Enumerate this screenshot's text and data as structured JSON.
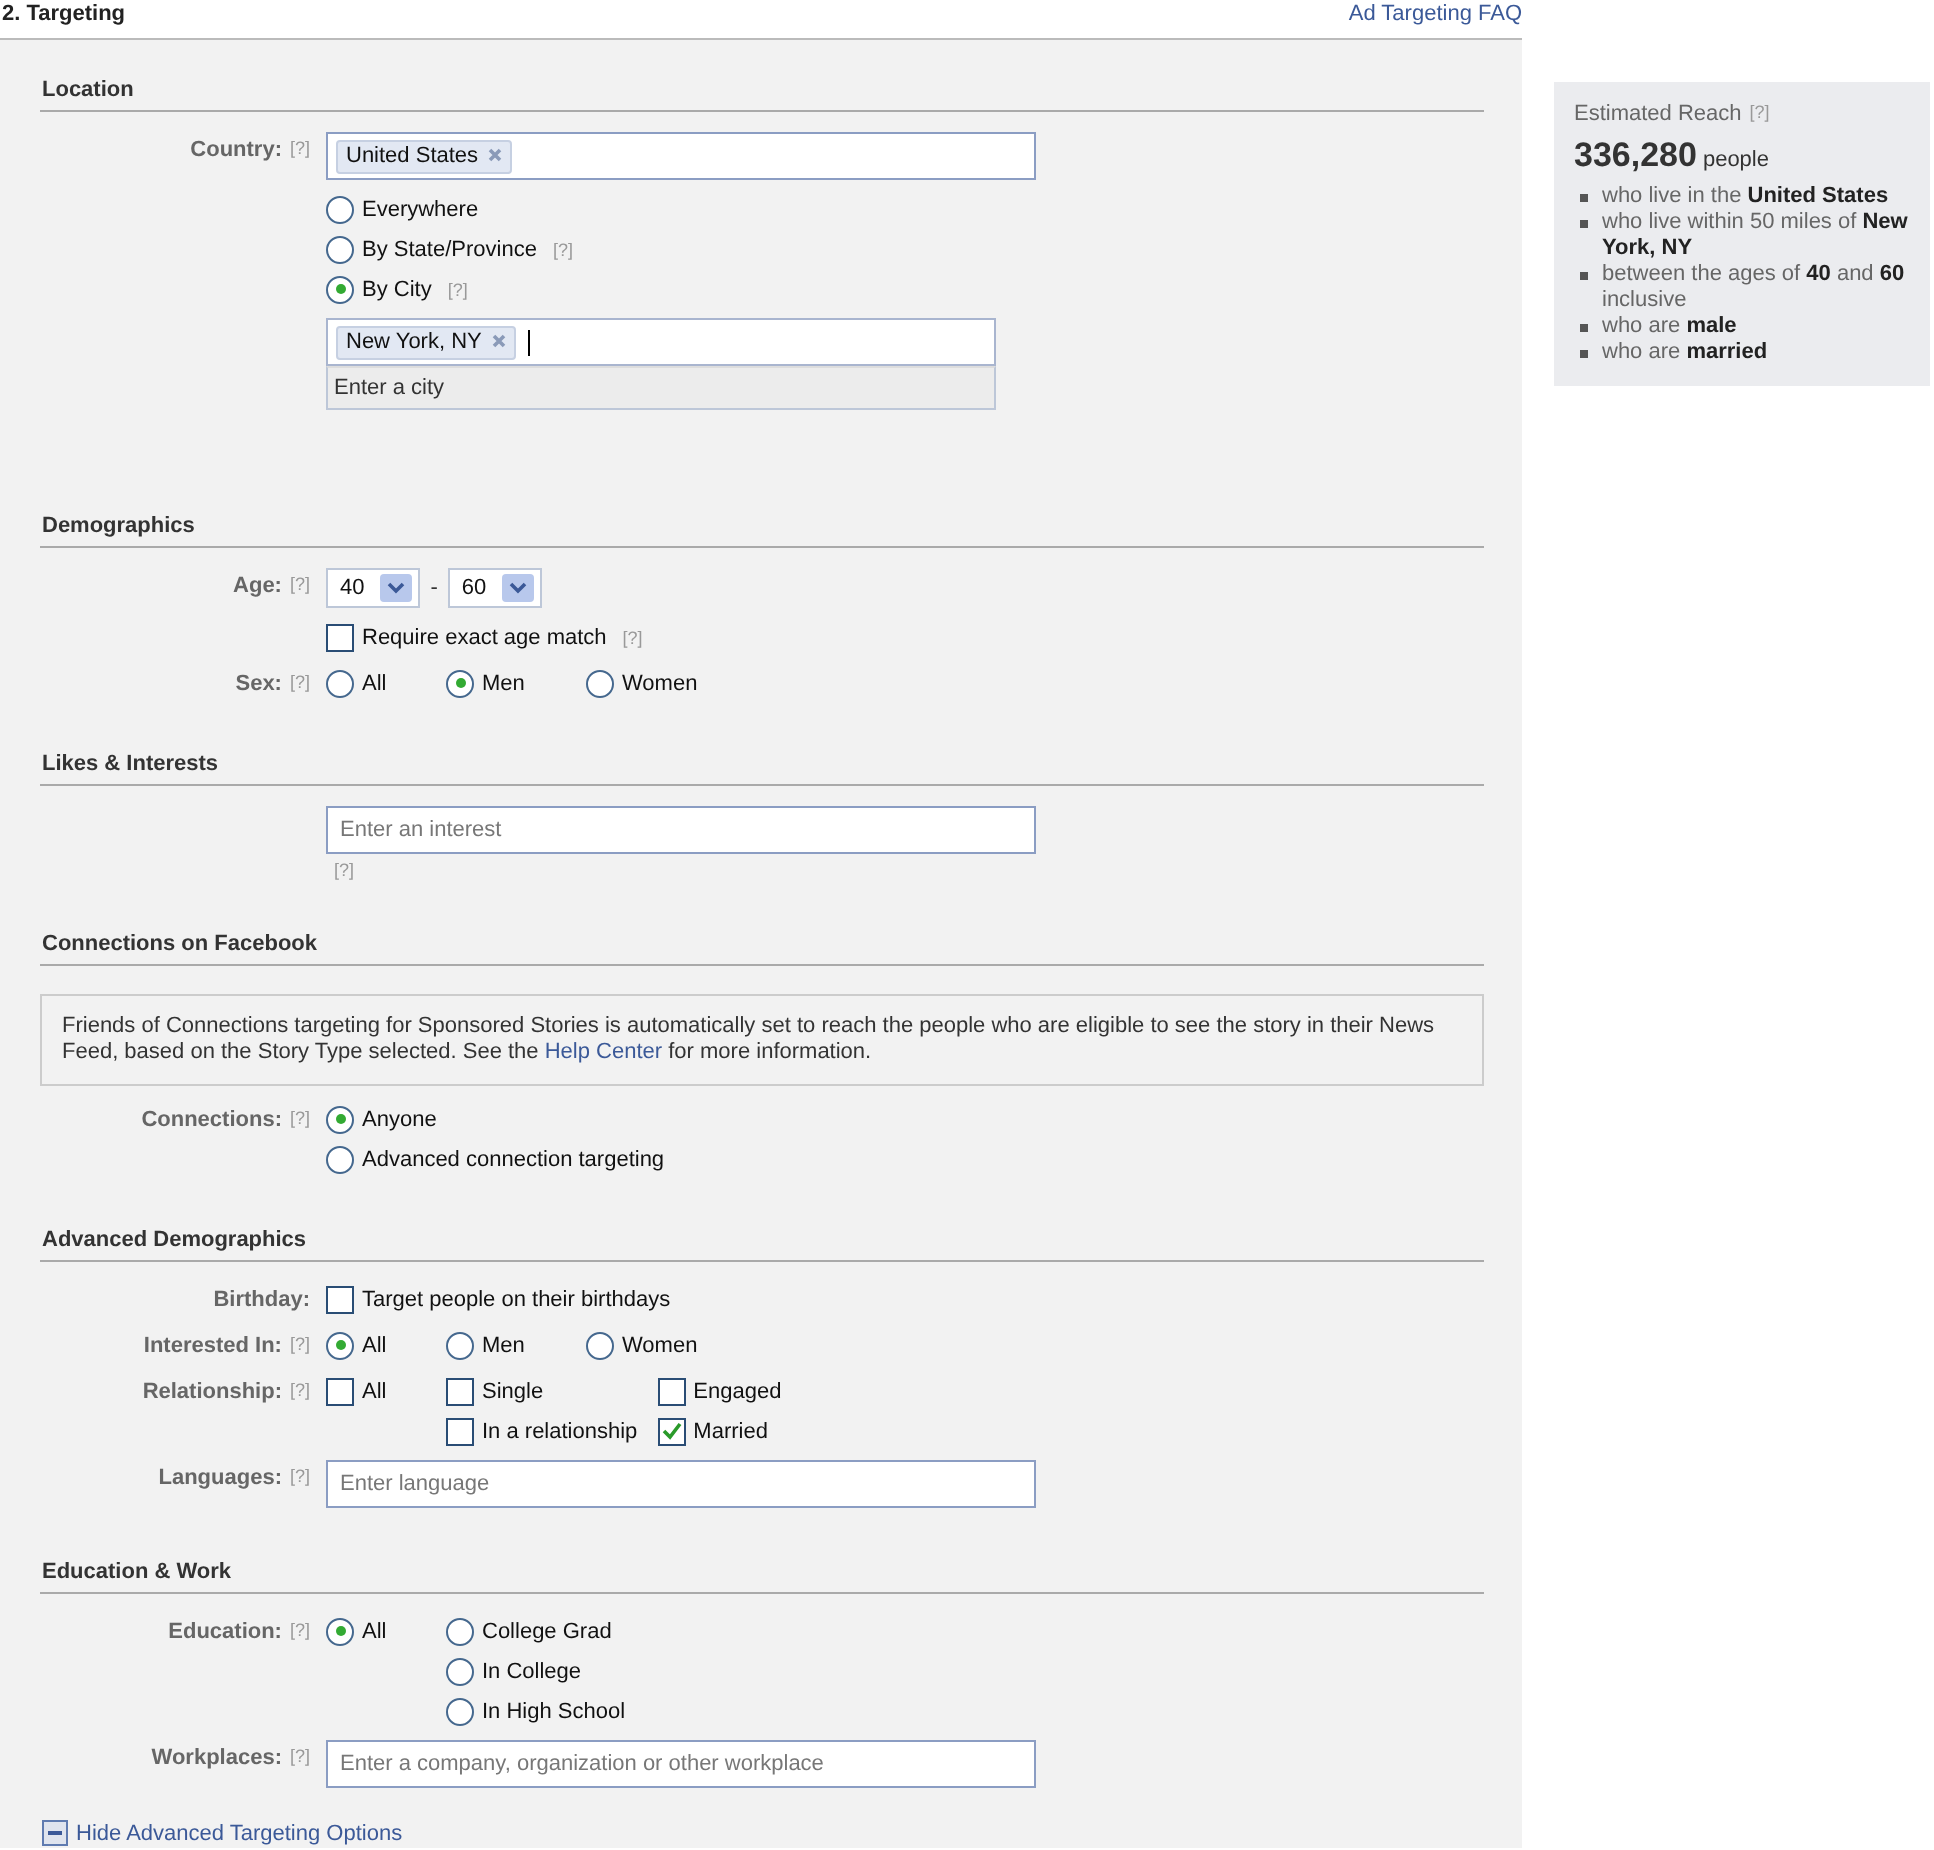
{
  "header": {
    "title": "2. Targeting",
    "link": "Ad Targeting FAQ"
  },
  "sections": [
    {
      "title": "Location",
      "rows": [
        {
          "kind": "token_field",
          "label": "Country:",
          "help": "[?]",
          "tokens": [
            "United States"
          ]
        },
        {
          "kind": "radio_grid",
          "columns": [
            [
              {
                "label": "Everywhere",
                "selected": false
              },
              {
                "label": "By State/Province",
                "help": "[?]",
                "selected": false
              },
              {
                "label": "By City",
                "help": "[?]",
                "selected": true
              }
            ]
          ]
        },
        {
          "kind": "city_picker",
          "tokens": [
            "New York, NY"
          ],
          "hint": "Enter a city"
        }
      ]
    },
    {
      "title": "Demographics",
      "rows": [
        {
          "kind": "age_range",
          "label": "Age:",
          "help": "[?]",
          "from": "40",
          "separator": "-",
          "to": "60"
        },
        {
          "kind": "checkbox_grid",
          "columns": [
            [
              {
                "label": "Require exact age match",
                "help": "[?]",
                "checked": false
              }
            ]
          ]
        },
        {
          "kind": "radio_grid",
          "label": "Sex:",
          "help": "[?]",
          "columns": [
            [
              {
                "label": "All",
                "selected": false
              }
            ],
            [
              {
                "label": "Men",
                "selected": true
              }
            ],
            [
              {
                "label": "Women",
                "selected": false
              }
            ]
          ]
        }
      ]
    },
    {
      "title": "Likes & Interests",
      "rows": [
        {
          "kind": "text_field",
          "placeholder": "Enter an interest",
          "help_below": "[?]"
        }
      ]
    },
    {
      "title": "Connections on Facebook",
      "rows": [
        {
          "kind": "notice",
          "text": "Friends of Connections targeting for Sponsored Stories is automatically set to reach the people who are eligible to see the story in their News Feed, based on the Story Type selected. See the",
          "link": "Help Center",
          "text_after": "for more information."
        },
        {
          "kind": "radio_grid",
          "label": "Connections:",
          "help": "[?]",
          "columns": [
            [
              {
                "label": "Anyone",
                "selected": true
              },
              {
                "label": "Advanced connection targeting",
                "selected": false
              }
            ]
          ]
        }
      ]
    },
    {
      "title": "Advanced Demographics",
      "rows": [
        {
          "kind": "checkbox_grid",
          "label": "Birthday:",
          "columns": [
            [
              {
                "label": "Target people on their birthdays",
                "checked": false
              }
            ]
          ]
        },
        {
          "kind": "radio_grid",
          "label": "Interested In:",
          "help": "[?]",
          "columns": [
            [
              {
                "label": "All",
                "selected": true
              }
            ],
            [
              {
                "label": "Men",
                "selected": false
              }
            ],
            [
              {
                "label": "Women",
                "selected": false
              }
            ]
          ]
        },
        {
          "kind": "checkbox_grid",
          "label": "Relationship:",
          "help": "[?]",
          "columns": [
            [
              {
                "label": "All",
                "checked": false
              }
            ],
            [
              {
                "label": "Single",
                "checked": false
              },
              {
                "label": "In a relationship",
                "checked": false
              }
            ],
            [
              {
                "label": "Engaged",
                "checked": false
              },
              {
                "label": "Married",
                "checked": true
              }
            ]
          ]
        },
        {
          "kind": "text_field",
          "label": "Languages:",
          "help": "[?]",
          "placeholder": "Enter language"
        }
      ]
    },
    {
      "title": "Education & Work",
      "rows": [
        {
          "kind": "radio_grid",
          "label": "Education:",
          "help": "[?]",
          "columns": [
            [
              {
                "label": "All",
                "selected": true
              }
            ],
            [
              {
                "label": "College Grad",
                "selected": false
              },
              {
                "label": "In College",
                "selected": false
              },
              {
                "label": "In High School",
                "selected": false
              }
            ]
          ]
        },
        {
          "kind": "text_field",
          "label": "Workplaces:",
          "help": "[?]",
          "placeholder": "Enter a company, organization or other workplace"
        }
      ]
    }
  ],
  "footer": {
    "toggle": "Hide Advanced Targeting Options"
  },
  "reach": {
    "title": "Estimated Reach",
    "help": "[?]",
    "count": "336,280",
    "unit": "people",
    "criteria": [
      "who live in the **United States**",
      "who live within 50 miles of **New York, NY**",
      "between the ages of **40** and **60** inclusive",
      "who are **male**",
      "who are **married**"
    ]
  }
}
